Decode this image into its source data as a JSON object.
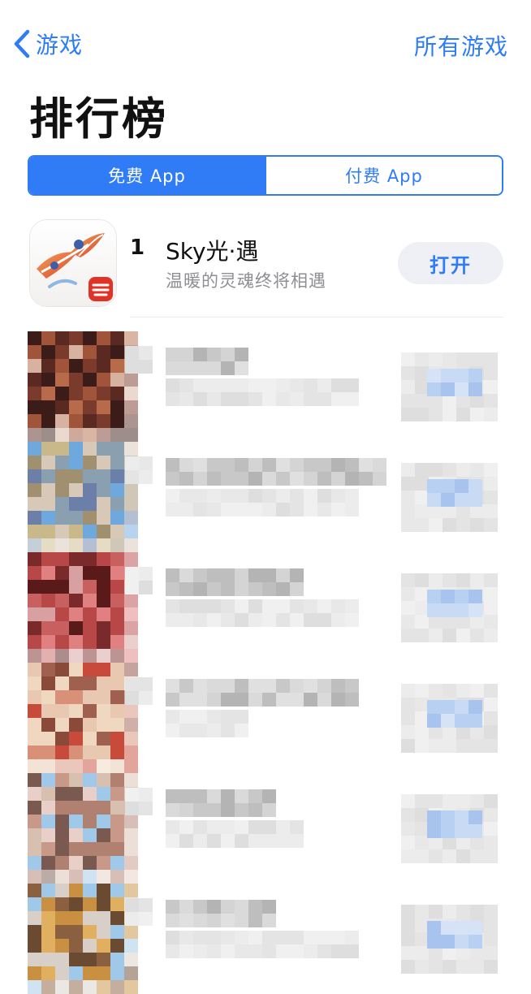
{
  "navbar": {
    "back_label": "游戏",
    "right_label": "所有游戏"
  },
  "page": {
    "title": "排行榜"
  },
  "tabs": [
    {
      "label": "免费 App",
      "active": true
    },
    {
      "label": "付费 App",
      "active": false
    }
  ],
  "apps": [
    {
      "rank": "1",
      "name": "Sky光·遇",
      "subtitle": "温暖的灵魂终将相遇",
      "action": "打开"
    }
  ],
  "blurred_rows": 6,
  "colors": {
    "accent": "#2f7cf6",
    "text": "#111111",
    "secondary": "#8e8e93",
    "button_bg": "#eef0f5"
  },
  "icons": [
    "chevron-left-icon",
    "sky-app-icon"
  ]
}
